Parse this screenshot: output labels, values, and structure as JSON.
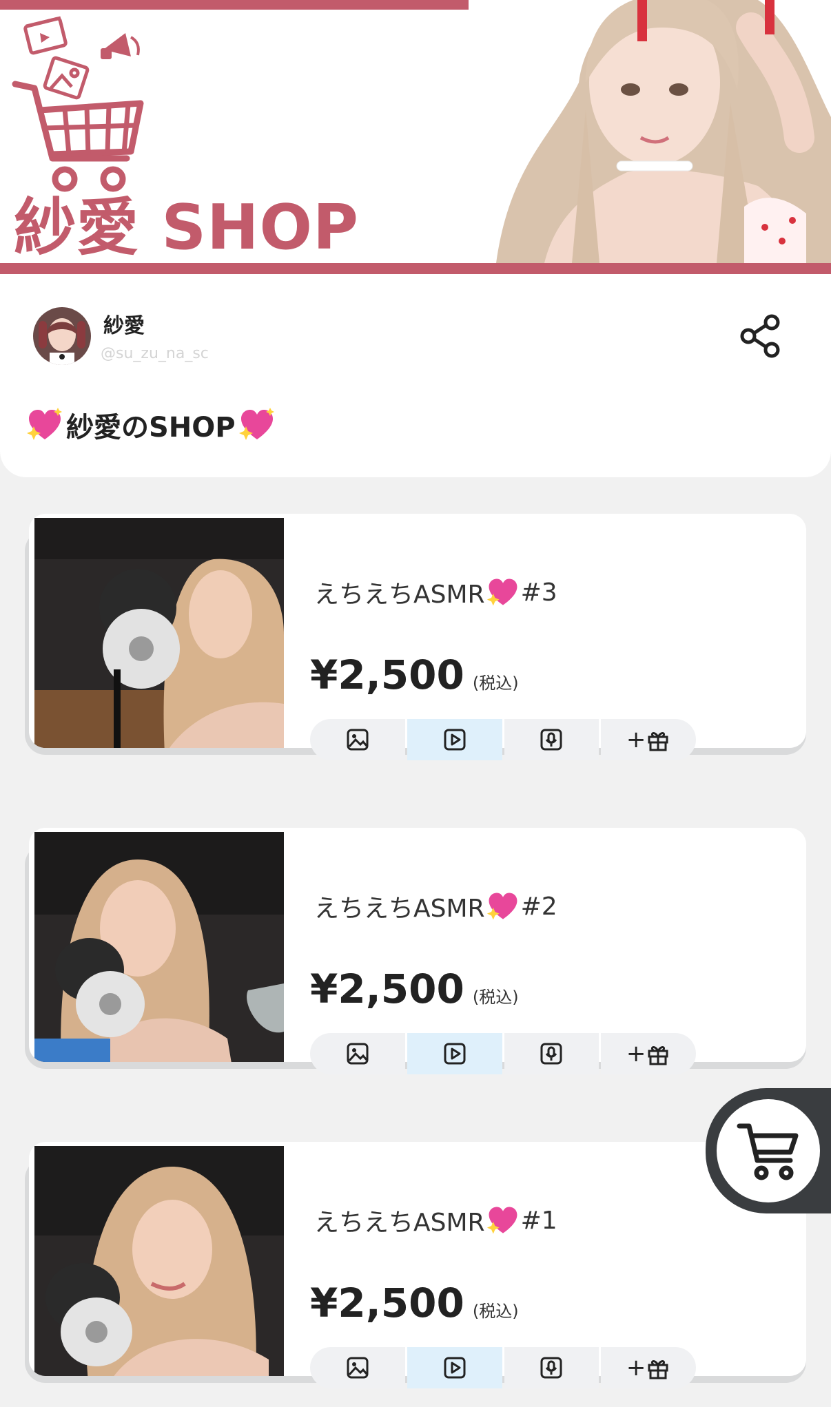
{
  "banner": {
    "title": "紗愛 SHOP",
    "brand_color": "#c25b6b"
  },
  "profile": {
    "name": "紗愛",
    "handle": "@su_zu_na_sc",
    "share_icon": "share-icon"
  },
  "shop": {
    "heading": "紗愛のSHOP"
  },
  "products": [
    {
      "title_prefix": "えちえちASMR",
      "title_suffix": "#3",
      "price": "¥2,500",
      "tax_label": "(税込)"
    },
    {
      "title_prefix": "えちえちASMR",
      "title_suffix": "#2",
      "price": "¥2,500",
      "tax_label": "(税込)"
    },
    {
      "title_prefix": "えちえちASMR",
      "title_suffix": "#1",
      "price": "¥2,500",
      "tax_label": "(税込)"
    }
  ],
  "content_types": {
    "image": "image-icon",
    "video": "video-play-icon",
    "audio": "microphone-icon",
    "gift_prefix": "+",
    "gift": "gift-icon",
    "active": "video"
  },
  "cart": {
    "icon": "cart-icon"
  }
}
